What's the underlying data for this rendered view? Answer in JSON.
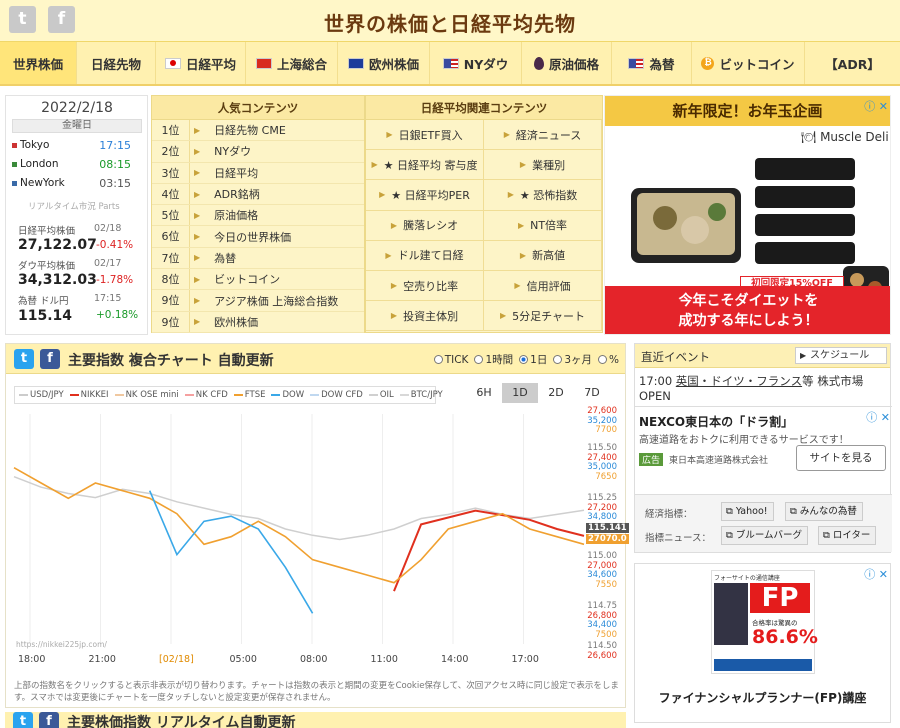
{
  "header": {
    "title": "世界の株価と日経平均先物",
    "twitter_icon": "twitter-icon",
    "facebook_icon": "facebook-icon"
  },
  "nav": [
    {
      "label": "世界株価",
      "icon": ""
    },
    {
      "label": "日経先物",
      "icon": ""
    },
    {
      "label": "日経平均",
      "icon": "flag-japan-icon"
    },
    {
      "label": "上海総合",
      "icon": "flag-china-icon"
    },
    {
      "label": "欧州株価",
      "icon": "flag-eu-icon"
    },
    {
      "label": "NYダウ",
      "icon": "flag-us-icon"
    },
    {
      "label": "原油価格",
      "icon": "oil-drop-icon"
    },
    {
      "label": "為替",
      "icon": "flag-us-icon"
    },
    {
      "label": "ビットコイン",
      "icon": "bitcoin-icon"
    },
    {
      "label": "【ADR】",
      "icon": ""
    }
  ],
  "market_box": {
    "date": "2022/2/18",
    "weekday": "金曜日",
    "cities": [
      {
        "name": "Tokyo",
        "time": "17:15",
        "color": "#2a7fd8"
      },
      {
        "name": "London",
        "time": "08:15",
        "color": "#1a9a2a"
      },
      {
        "name": "NewYork",
        "time": "03:15",
        "color": "#555555"
      }
    ],
    "realtime_label": "リアルタイム市況 Parts",
    "markets": [
      {
        "label": "日経平均株価",
        "date": "02/18",
        "value": "27,122.07",
        "change": "-0.41%"
      },
      {
        "label": "ダウ平均株価",
        "date": "02/17",
        "value": "34,312.03",
        "change": "-1.78%"
      },
      {
        "label": "為替 ドル円",
        "date": "17:15",
        "value": "115.14",
        "change": "+0.18%"
      }
    ]
  },
  "ranking": {
    "header": "人気コンテンツ",
    "rows": [
      {
        "rank": "1位",
        "label": "日経先物 CME"
      },
      {
        "rank": "2位",
        "label": "NYダウ"
      },
      {
        "rank": "3位",
        "label": "日経平均"
      },
      {
        "rank": "4位",
        "label": "ADR銘柄"
      },
      {
        "rank": "5位",
        "label": "原油価格"
      },
      {
        "rank": "6位",
        "label": "今日の世界株価"
      },
      {
        "rank": "7位",
        "label": "為替"
      },
      {
        "rank": "8位",
        "label": "ビットコイン"
      },
      {
        "rank": "9位",
        "label": "アジア株価 上海総合指数"
      },
      {
        "rank": "9位",
        "label": "欧州株価"
      }
    ]
  },
  "related": {
    "header": "日経平均関連コンテンツ",
    "cells": [
      "日銀ETF買入",
      "経済ニュース",
      "★ 日経平均 寄与度",
      "業種別",
      "★ 日経平均PER",
      "★ 恐怖指数",
      "騰落レシオ",
      "NT倍率",
      "ドル建て日経",
      "新高値",
      "空売り比率",
      "信用評価",
      "投資主体別",
      "5分足チャート"
    ]
  },
  "ad1": {
    "top": "新年限定！お年玉企画",
    "brand": "Muscle Deli",
    "badge": "初回限定15%OFF",
    "bottom_line1": "今年こそダイエットを",
    "bottom_line2": "成功する年にしよう！"
  },
  "chart_panel": {
    "title": "主要指数 複合チャート 自動更新",
    "radios": [
      {
        "label": "TICK",
        "on": false
      },
      {
        "label": "1時間",
        "on": false
      },
      {
        "label": "1日",
        "on": true
      },
      {
        "label": "3ヶ月",
        "on": false
      },
      {
        "label": "%",
        "on": false
      }
    ],
    "periods": [
      {
        "label": "6H",
        "on": false
      },
      {
        "label": "1D",
        "on": true
      },
      {
        "label": "2D",
        "on": false
      },
      {
        "label": "7D",
        "on": false
      }
    ],
    "watermark": "https://nikkei225jp.com/",
    "note": "上部の指数名をクリックすると表示非表示が切り替わります。チャートは指数の表示と期間の変更をCookie保存して、次回アクセス時に同じ設定で表示をします。スマホでは変更後にチャートを一度タッチしないと設定変更が保存されません。",
    "next_title": "主要株価指数 リアルタイム自動更新"
  },
  "chart_data": {
    "type": "line",
    "legend": [
      {
        "name": "USD/JPY",
        "color": "#cccccc"
      },
      {
        "name": "NIKKEI",
        "color": "#e0301e"
      },
      {
        "name": "NK OSE mini",
        "color": "#f0c8a0"
      },
      {
        "name": "NK CFD",
        "color": "#f5a0a0"
      },
      {
        "name": "FTSE",
        "color": "#f0a030"
      },
      {
        "name": "DOW",
        "color": "#3aa8e8"
      },
      {
        "name": "DOW CFD",
        "color": "#c0d8f0"
      },
      {
        "name": "OIL",
        "color": "#d0d0d0"
      },
      {
        "name": "BTC/JPY",
        "color": "#d8d8d8"
      }
    ],
    "x_ticks": [
      "18:00",
      "21:00",
      "[02/18]",
      "05:00",
      "08:00",
      "11:00",
      "14:00",
      "17:00"
    ],
    "right_axis_ticks": [
      {
        "values": [
          "27,600",
          "35,200",
          "7700"
        ]
      },
      {
        "values": [
          "115.50",
          "27,400",
          "35,000",
          "7650"
        ]
      },
      {
        "values": [
          "115.25",
          "27,200",
          "34,800"
        ]
      },
      {
        "values": [
          "115.00",
          "27,000",
          "34,600",
          "7550"
        ]
      },
      {
        "values": [
          "114.75",
          "26,800",
          "34,400",
          "7500"
        ]
      },
      {
        "values": [
          "114.50",
          "26,600"
        ]
      }
    ],
    "current_labels": [
      "115.141",
      "27070.0"
    ],
    "series": [
      {
        "name": "USD/JPY",
        "values": [
          115.3,
          115.25,
          115.22,
          115.2,
          115.24,
          115.22,
          115.18,
          115.15,
          115.12,
          115.1,
          115.05,
          115.02,
          115.0,
          115.02,
          115.05,
          115.1,
          115.12,
          115.15,
          115.12,
          115.1,
          115.12,
          115.14
        ]
      },
      {
        "name": "NIKKEI",
        "values": [
          null,
          null,
          null,
          null,
          null,
          null,
          null,
          null,
          null,
          null,
          null,
          null,
          null,
          null,
          26830,
          27120,
          27150,
          27180,
          27160,
          27140,
          27100,
          27070
        ]
      },
      {
        "name": "FTSE",
        "values": [
          7680,
          7660,
          7640,
          7660,
          7650,
          7640,
          7620,
          7580,
          7590,
          7610,
          7590,
          7560,
          7550,
          7540,
          7530,
          7560,
          7600,
          7610,
          7620,
          7600,
          7590,
          7580
        ]
      },
      {
        "name": "DOW",
        "values": [
          null,
          null,
          null,
          null,
          null,
          34900,
          34650,
          34780,
          34800,
          34750,
          34600,
          34420,
          null,
          null,
          null,
          null,
          null,
          null,
          null,
          null,
          null,
          null
        ]
      }
    ]
  },
  "events": {
    "title": "直近イベント",
    "schedule_label": "スケジュール",
    "text_prefix": "17:00 ",
    "text_link": "英国・ドイツ・フランス",
    "text_suffix": "等 株式市場 OPEN",
    "ad_title": "NEXCO東日本の「ドラ割」",
    "ad_sub": "高速道路をおトクに利用できるサービスです！",
    "ad_tag": "広告",
    "ad_advertiser": "東日本高速道路株式会社",
    "ad_button": "サイトを見る",
    "indicators_label": "経済指標：",
    "indicator_links": [
      "Yahoo!",
      "みんなの為替"
    ],
    "news_label": "指標ニュース：",
    "news_links": [
      "ブルームバーグ",
      "ロイター"
    ]
  },
  "ad3": {
    "brand": "フォーサイトの通信講座",
    "big": "FP",
    "rate_label": "合格率は驚異の",
    "rate": "86.6%",
    "caption": "ファイナンシャルプランナー(FP)講座"
  }
}
